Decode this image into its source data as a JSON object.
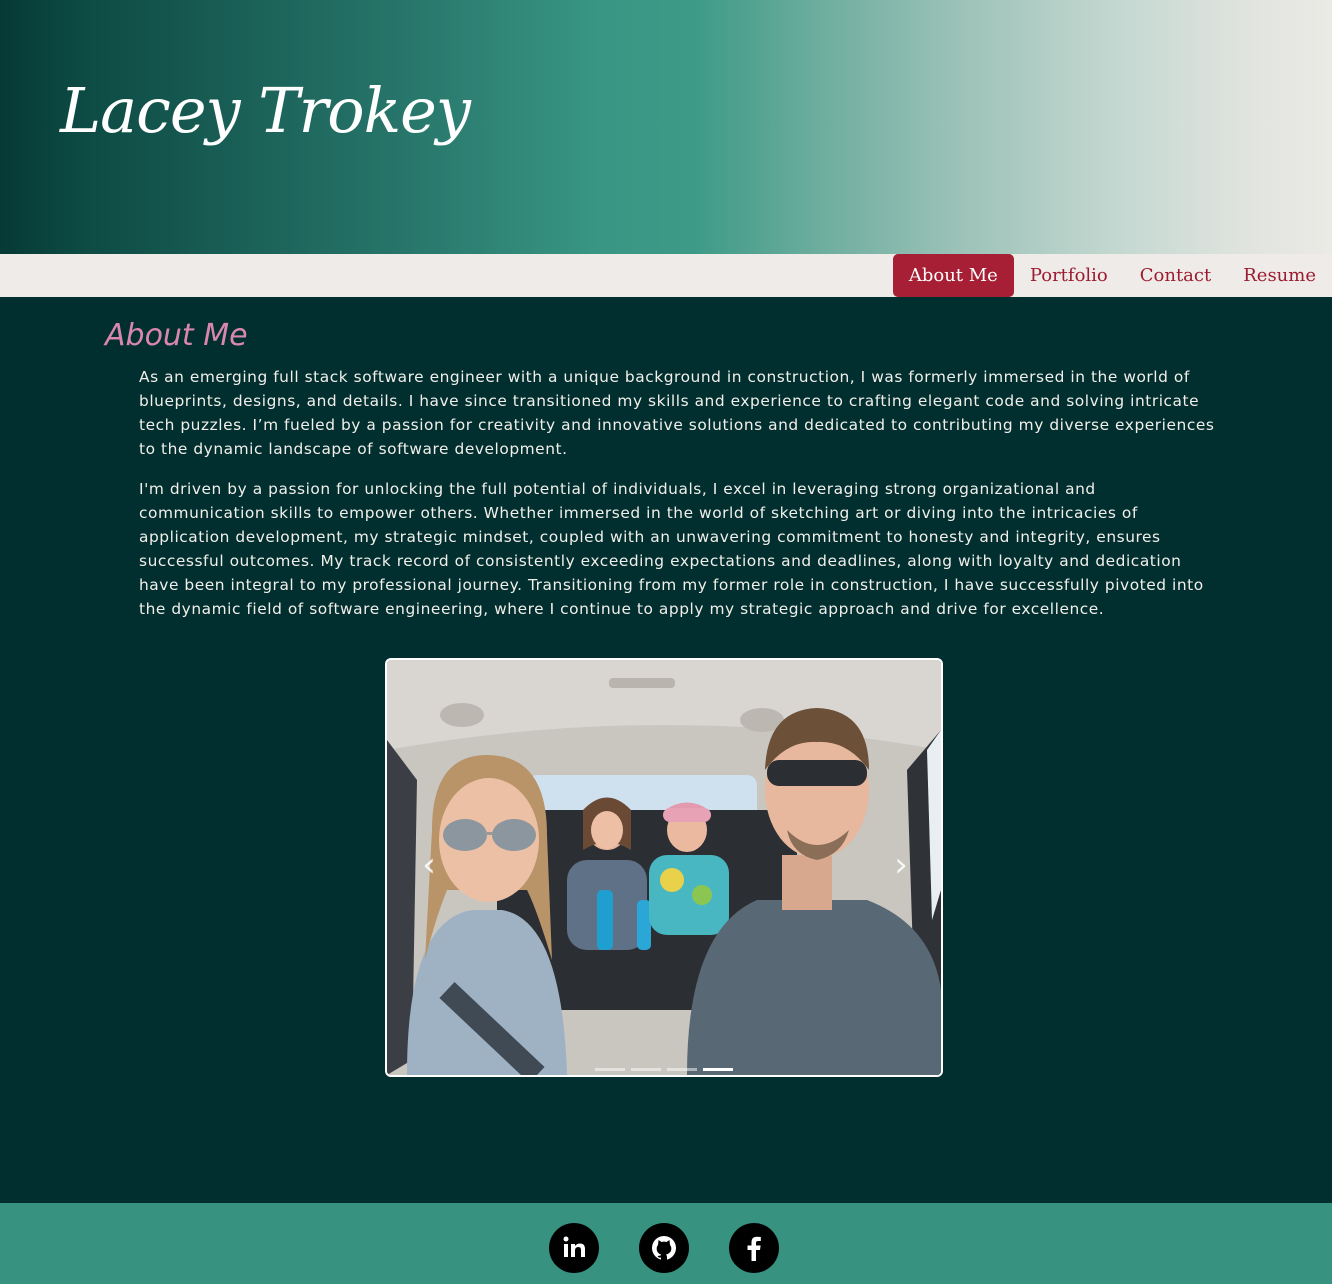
{
  "header": {
    "site_title": "Lacey Trokey"
  },
  "nav": {
    "items": [
      {
        "label": "About Me",
        "active": true
      },
      {
        "label": "Portfolio",
        "active": false
      },
      {
        "label": "Contact",
        "active": false
      },
      {
        "label": "Resume",
        "active": false
      }
    ]
  },
  "about": {
    "title": "About Me",
    "paragraphs": [
      "As an emerging full stack software engineer with a unique background in construction, I was formerly immersed in the world of blueprints, designs, and details. I have since transitioned my skills and experience to crafting elegant code and solving intricate tech puzzles. I’m fueled by a passion for creativity and innovative solutions and dedicated to contributing my diverse experiences to the dynamic landscape of software development.",
      "I'm driven by a passion for unlocking the full potential of individuals, I excel in leveraging strong organizational and communication skills to empower others. Whether immersed in the world of sketching art or diving into the intricacies of application development, my strategic mindset, coupled with an unwavering commitment to honesty and integrity, ensures successful outcomes. My track record of consistently exceeding expectations and deadlines, along with loyalty and dedication have been integral to my professional journey. Transitioning from my former role in construction, I have successfully pivoted into the dynamic field of software engineering, where I continue to apply my strategic approach and drive for excellence."
    ]
  },
  "carousel": {
    "prev_icon": "chevron-left-icon",
    "next_icon": "chevron-right-icon",
    "slide_count": 4,
    "active_slide": 4
  },
  "footer": {
    "social_icons": [
      "linkedin-icon",
      "github-icon",
      "facebook-icon"
    ]
  },
  "colors": {
    "page_bg": "#012f2f",
    "nav_bg": "#efebe8",
    "accent": "#a61f34",
    "title_pink": "#d987ad",
    "footer_bg": "#379380"
  }
}
